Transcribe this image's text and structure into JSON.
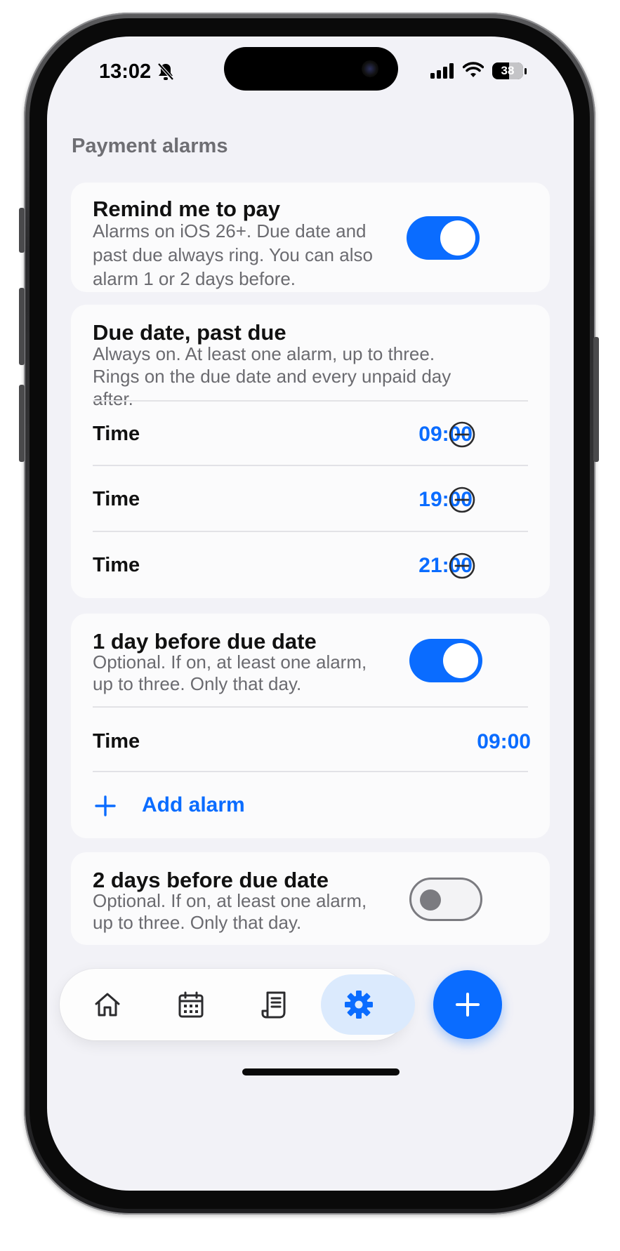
{
  "status_bar": {
    "time": "13:02",
    "battery": "38",
    "icons": [
      "bell-slash-icon",
      "signal-icon",
      "wifi-icon",
      "battery-icon"
    ]
  },
  "section_title": "Payment alarms",
  "remind_card": {
    "title": "Remind me to pay",
    "description": "Alarms on iOS 26+. Due date and past due always ring. You can also alarm 1 or 2 days before.",
    "toggle_on": true
  },
  "due_card": {
    "title": "Due date, past due",
    "description": "Always on. At least one alarm, up to three. Rings on the due date and every unpaid day after.",
    "rows": [
      {
        "label": "Time",
        "time": "09:00"
      },
      {
        "label": "Time",
        "time": "19:00"
      },
      {
        "label": "Time",
        "time": "21:00"
      }
    ]
  },
  "one_day_card": {
    "title": "1 day before due date",
    "description": "Optional. If on, at least one alarm, up to three. Only that day.",
    "toggle_on": true,
    "rows": [
      {
        "label": "Time",
        "time": "09:00"
      }
    ],
    "add_label": "Add alarm"
  },
  "two_day_card": {
    "title": "2 days before due date",
    "description": "Optional. If on, at least one alarm, up to three. Only that day.",
    "toggle_on": false
  },
  "tabbar": {
    "tabs": [
      {
        "icon": "home-icon"
      },
      {
        "icon": "calendar-icon"
      },
      {
        "icon": "receipt-icon"
      },
      {
        "icon": "gear-icon",
        "active": true
      }
    ],
    "fab_icon": "plus-icon"
  },
  "colors": {
    "accent": "#0a6cff",
    "background": "#f2f2f7",
    "card": "#fbfbfc",
    "active_tab": "#dbeafd"
  }
}
